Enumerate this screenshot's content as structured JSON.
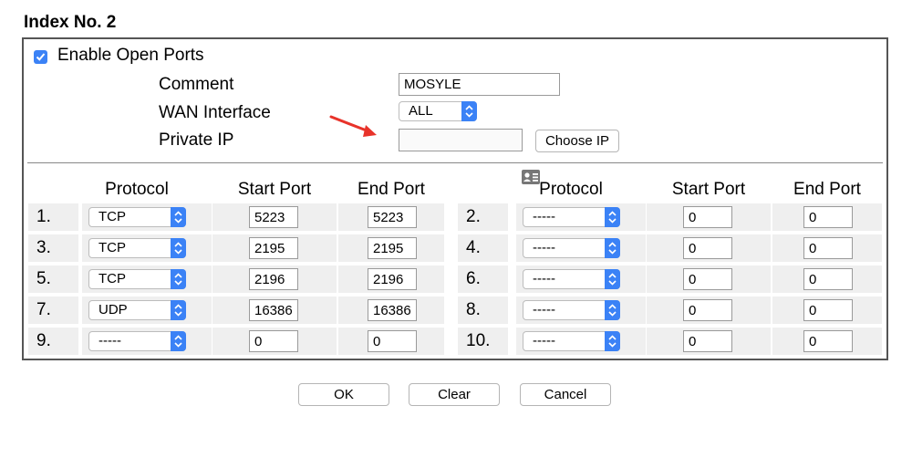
{
  "title": "Index No. 2",
  "enable_label": "Enable Open Ports",
  "enable_checked": true,
  "comment_label": "Comment",
  "comment_value": "MOSYLE",
  "wan_label": "WAN Interface",
  "wan_value": "ALL",
  "private_ip_label": "Private IP",
  "private_ip_value": "",
  "choose_ip_label": "Choose IP",
  "columns": {
    "protocol": "Protocol",
    "start": "Start Port",
    "end": "End Port"
  },
  "rows": [
    {
      "num": "1.",
      "protocol": "TCP",
      "start": "5223",
      "end": "5223"
    },
    {
      "num": "2.",
      "protocol": "-----",
      "start": "0",
      "end": "0"
    },
    {
      "num": "3.",
      "protocol": "TCP",
      "start": "2195",
      "end": "2195"
    },
    {
      "num": "4.",
      "protocol": "-----",
      "start": "0",
      "end": "0"
    },
    {
      "num": "5.",
      "protocol": "TCP",
      "start": "2196",
      "end": "2196"
    },
    {
      "num": "6.",
      "protocol": "-----",
      "start": "0",
      "end": "0"
    },
    {
      "num": "7.",
      "protocol": "UDP",
      "start": "16386",
      "end": "16386"
    },
    {
      "num": "8.",
      "protocol": "-----",
      "start": "0",
      "end": "0"
    },
    {
      "num": "9.",
      "protocol": "-----",
      "start": "0",
      "end": "0"
    },
    {
      "num": "10.",
      "protocol": "-----",
      "start": "0",
      "end": "0"
    }
  ],
  "buttons": {
    "ok": "OK",
    "clear": "Clear",
    "cancel": "Cancel"
  },
  "colors": {
    "accent": "#3b82f6",
    "arrow": "#e8332a",
    "cell_bg": "#efefef"
  }
}
